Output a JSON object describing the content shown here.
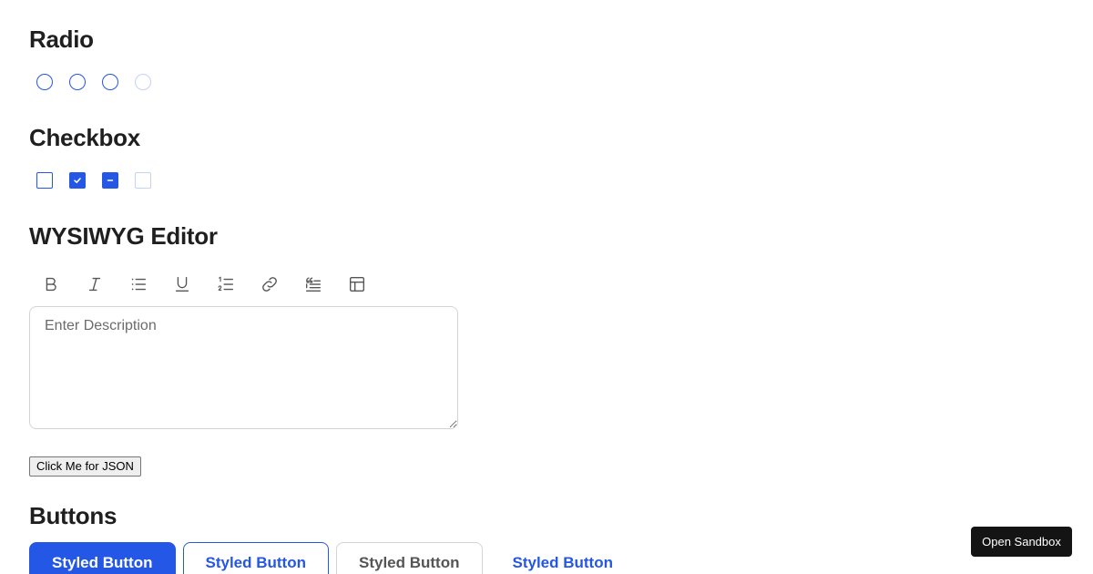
{
  "radio": {
    "title": "Radio",
    "items": [
      {
        "state": "unchecked"
      },
      {
        "state": "unchecked"
      },
      {
        "state": "unchecked"
      },
      {
        "state": "disabled"
      }
    ]
  },
  "checkbox": {
    "title": "Checkbox",
    "items": [
      {
        "state": "unchecked"
      },
      {
        "state": "checked"
      },
      {
        "state": "indeterminate"
      },
      {
        "state": "disabled"
      }
    ]
  },
  "editor": {
    "title": "WYSIWYG Editor",
    "toolbar": [
      "bold-icon",
      "italic-icon",
      "bullet-list-icon",
      "underline-icon",
      "numbered-list-icon",
      "link-icon",
      "quote-icon",
      "table-icon"
    ],
    "placeholder": "Enter Description",
    "value": ""
  },
  "json_button": {
    "label": "Click Me for JSON"
  },
  "buttons": {
    "title": "Buttons",
    "items": [
      {
        "label": "Styled Button",
        "variant": "primary"
      },
      {
        "label": "Styled Button",
        "variant": "outline"
      },
      {
        "label": "Styled Button",
        "variant": "neutral"
      },
      {
        "label": "Styled Button",
        "variant": "ghost"
      }
    ]
  },
  "sandbox": {
    "label": "Open Sandbox"
  },
  "colors": {
    "accent": "#2457e6",
    "disabled": "#c4d2f5",
    "text": "#1f1f1f",
    "sandbox_bg": "#141414"
  }
}
